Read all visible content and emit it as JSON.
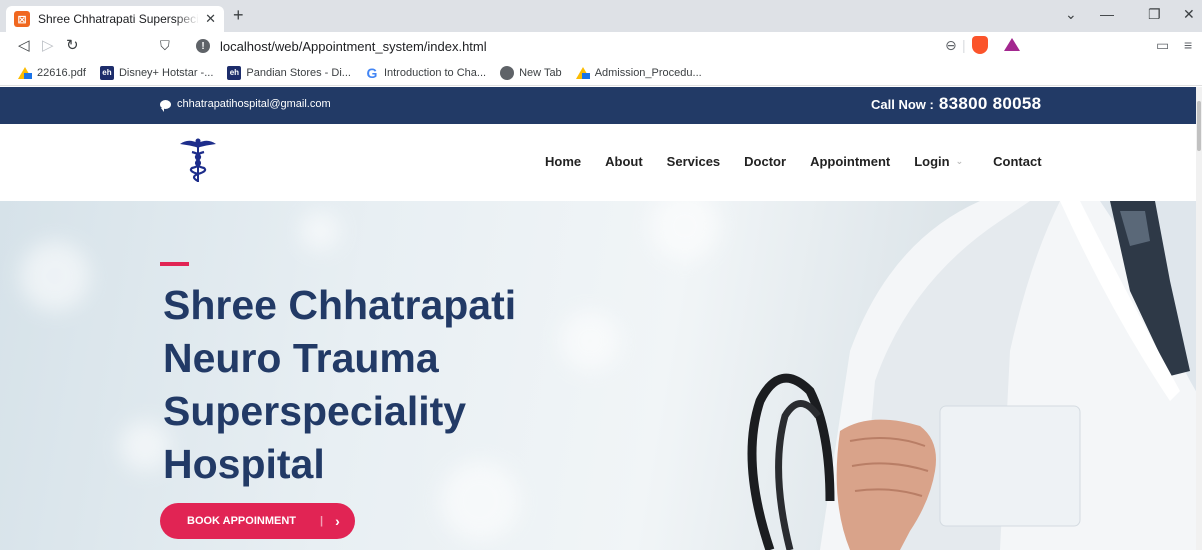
{
  "browser": {
    "tab_title": "Shree Chhatrapati Superspeciality",
    "tab_favicon": "xampp-icon",
    "url": "localhost/web/Appointment_system/index.html",
    "bookmarks": [
      {
        "label": "22616.pdf",
        "icon": "google-drive-icon"
      },
      {
        "label": "Disney+ Hotstar -...",
        "icon": "eh-icon"
      },
      {
        "label": "Pandian Stores - Di...",
        "icon": "eh-icon"
      },
      {
        "label": "Introduction to Cha...",
        "icon": "google-icon"
      },
      {
        "label": "New Tab",
        "icon": "chrome-icon"
      },
      {
        "label": "Admission_Procedu...",
        "icon": "google-drive-icon"
      }
    ]
  },
  "topbar": {
    "email": "chhatrapatihospital@gmail.com",
    "call_label": "Call Now :",
    "call_number": "83800 80058",
    "bg_color": "#223a66"
  },
  "nav": {
    "items": [
      "Home",
      "About",
      "Services",
      "Doctor",
      "Appointment",
      "Login",
      "Contact"
    ]
  },
  "hero": {
    "title_line1": "Shree Chhatrapati",
    "title_line2": "Neuro Trauma",
    "title_line3": "Superspeciality",
    "title_line4": "Hospital",
    "button_label": "BOOK APPOINMENT",
    "button_arrow": "›",
    "accent_color": "#e12454",
    "title_color": "#223a66"
  }
}
